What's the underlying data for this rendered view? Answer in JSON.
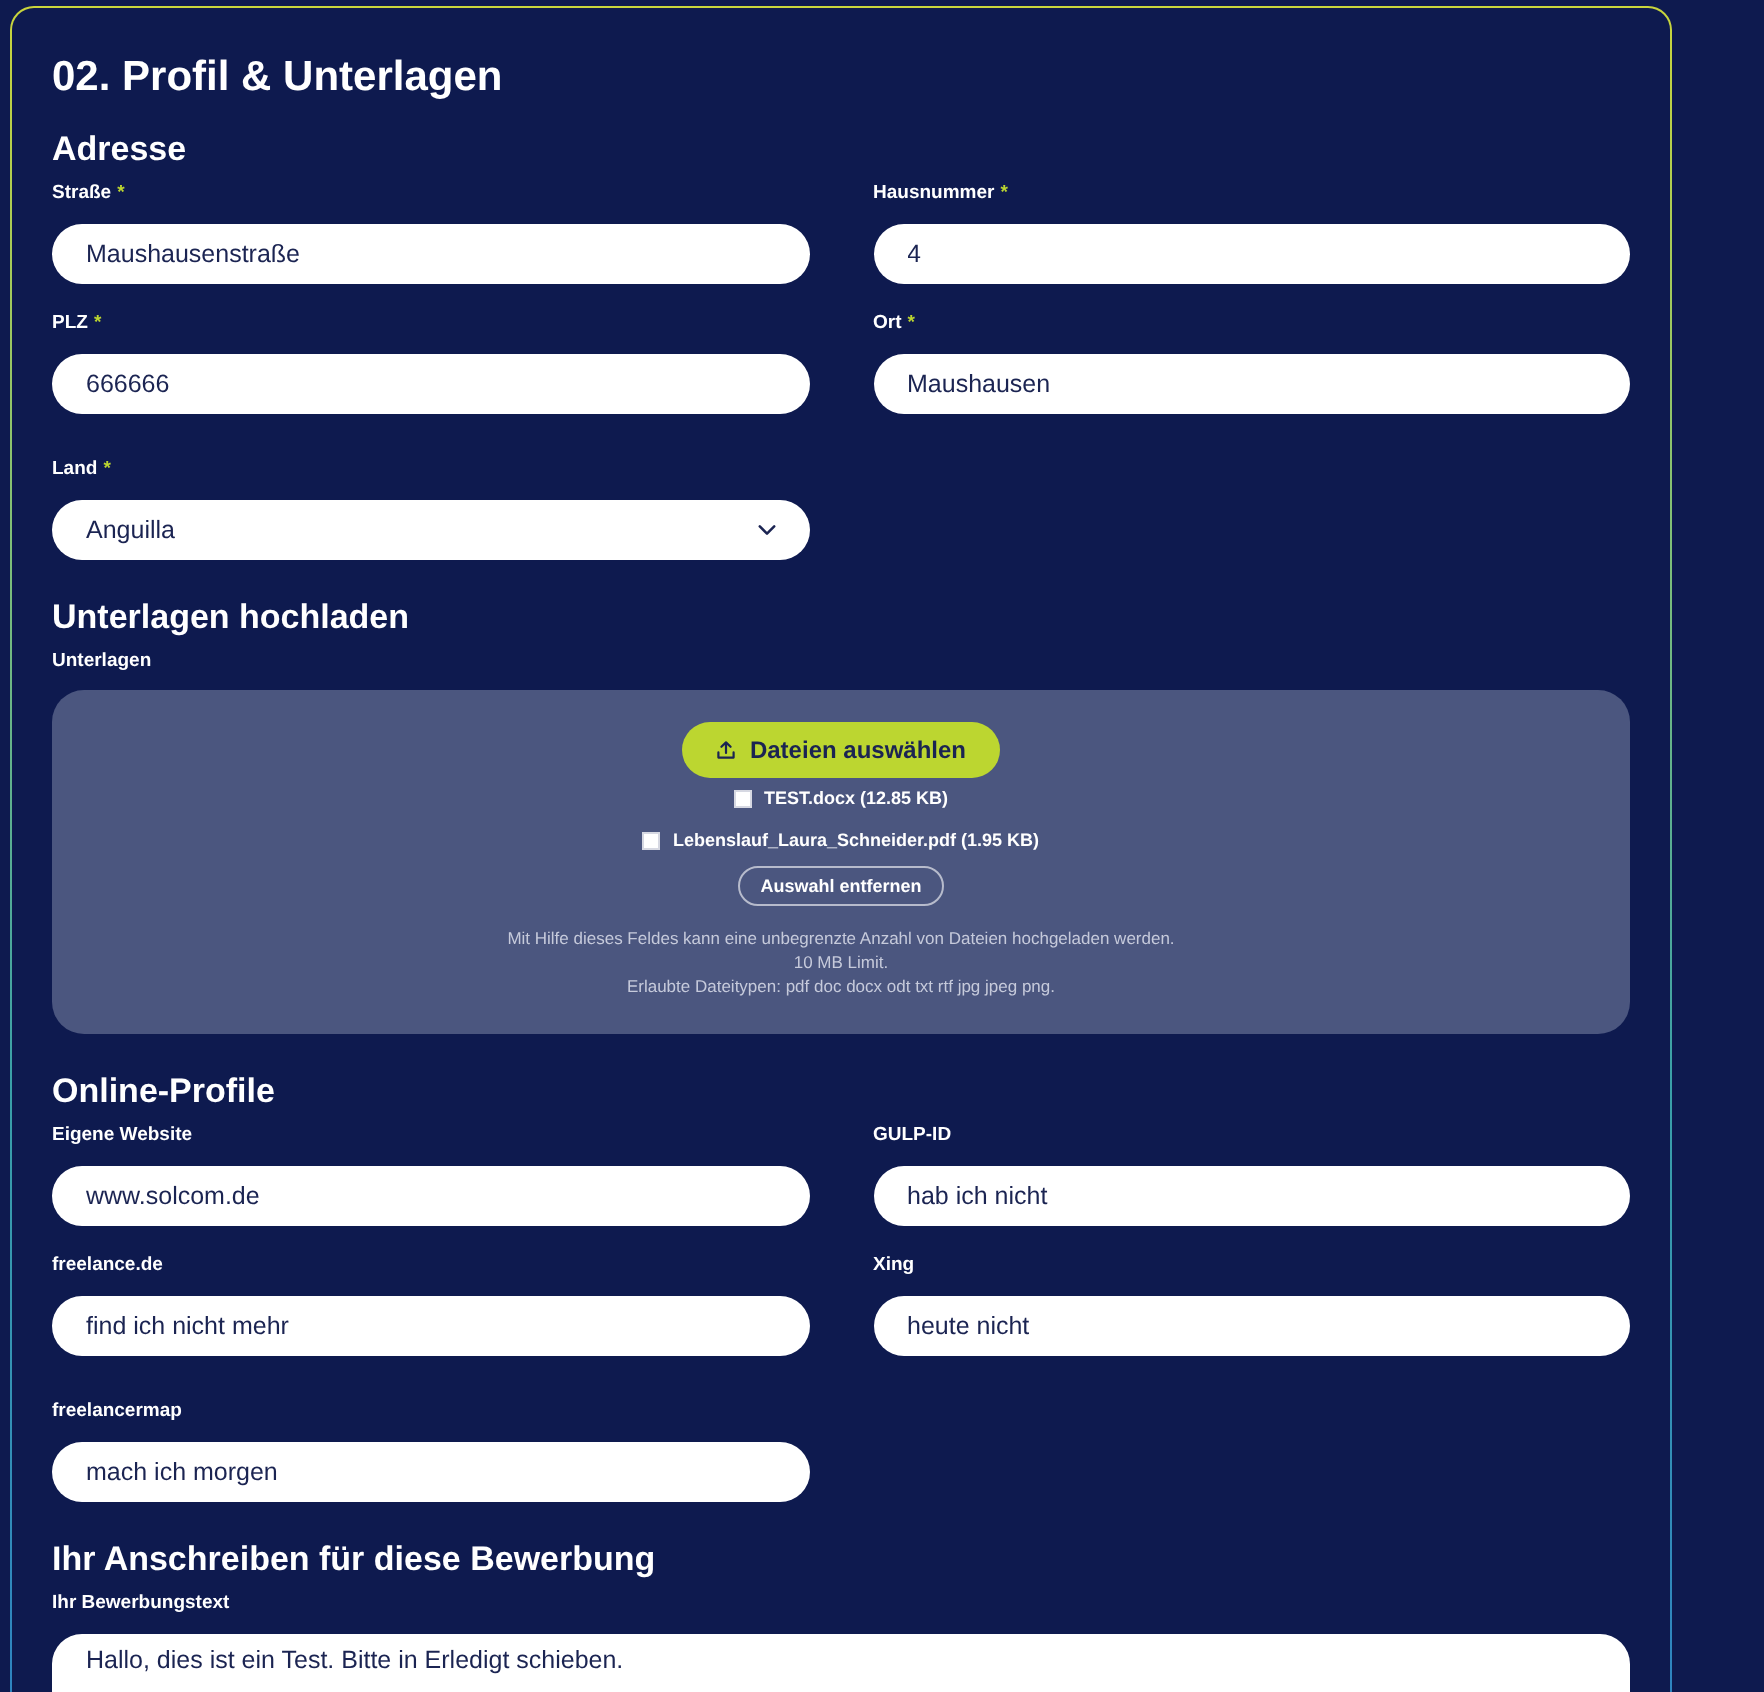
{
  "section": {
    "title": "02. Profil & Unterlagen"
  },
  "address": {
    "heading": "Adresse",
    "fields": [
      {
        "kind": "text",
        "label": "Straße",
        "marker": "*",
        "value": "Maushausenstraße"
      },
      {
        "kind": "text",
        "label": "Hausnummer",
        "marker": "*",
        "value": "4"
      },
      {
        "kind": "text",
        "label": "PLZ",
        "marker": "*",
        "value": "666666"
      },
      {
        "kind": "text",
        "label": "Ort",
        "marker": "*",
        "value": "Maushausen"
      },
      {
        "kind": "select",
        "label": "Land",
        "marker": "*",
        "value": "Anguilla"
      }
    ]
  },
  "upload": {
    "heading": "Unterlagen hochladen",
    "label": "Unterlagen",
    "button": "Dateien auswählen",
    "files": [
      {
        "name": "TEST.docx (12.85 KB)",
        "checked": false
      },
      {
        "name": "Lebenslauf_Laura_Schneider.pdf (1.95 KB)",
        "checked": false
      }
    ],
    "clear_button": "Auswahl entfernen",
    "help": [
      "Mit Hilfe dieses Feldes kann eine unbegrenzte Anzahl von Dateien hochgeladen werden.",
      "10 MB Limit.",
      "Erlaubte Dateitypen: pdf doc docx odt txt rtf jpg jpeg png."
    ]
  },
  "online_profiles": {
    "heading": "Online-Profile",
    "fields": [
      {
        "kind": "text",
        "label": "Eigene Website",
        "value": "www.solcom.de"
      },
      {
        "kind": "text",
        "label": "GULP-ID",
        "value": "hab ich nicht"
      },
      {
        "kind": "text",
        "label": "freelance.de",
        "value": "find ich nicht mehr"
      },
      {
        "kind": "text",
        "label": "Xing",
        "value": "heute nicht"
      },
      {
        "kind": "text",
        "label": "freelancermap",
        "value": "mach ich morgen"
      }
    ]
  },
  "cover_letter": {
    "heading": "Ihr Anschreiben für diese Bewerbung",
    "label": "Ihr Bewerbungstext",
    "value": "Hallo, dies ist ein Test. Bitte in Erledigt schieben."
  }
}
